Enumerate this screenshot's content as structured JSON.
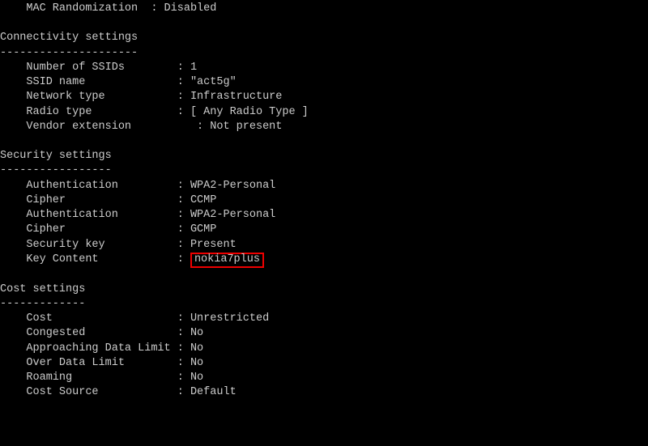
{
  "top": {
    "mac_rand_label": "    MAC Randomization  ",
    "mac_rand_value": " Disabled"
  },
  "sections": {
    "connectivity": {
      "title": "Connectivity settings",
      "dashes": "---------------------",
      "rows": {
        "num_ssids": {
          "label": "    Number of SSIDs        ",
          "value": " 1"
        },
        "ssid_name": {
          "label": "    SSID name              ",
          "value": " \"act5g\""
        },
        "network_type": {
          "label": "    Network type           ",
          "value": " Infrastructure"
        },
        "radio_type": {
          "label": "    Radio type             ",
          "value": " [ Any Radio Type ]"
        },
        "vendor_ext": {
          "label": "    Vendor extension          ",
          "value": " Not present"
        }
      }
    },
    "security": {
      "title": "Security settings",
      "dashes": "-----------------",
      "rows": {
        "auth1": {
          "label": "    Authentication         ",
          "value": " WPA2-Personal"
        },
        "cipher1": {
          "label": "    Cipher                 ",
          "value": " CCMP"
        },
        "auth2": {
          "label": "    Authentication         ",
          "value": " WPA2-Personal"
        },
        "cipher2": {
          "label": "    Cipher                 ",
          "value": " GCMP"
        },
        "sec_key": {
          "label": "    Security key           ",
          "value": " Present"
        },
        "key_content": {
          "label": "    Key Content            ",
          "value": "nokia7plus"
        }
      }
    },
    "cost": {
      "title": "Cost settings",
      "dashes": "-------------",
      "rows": {
        "cost": {
          "label": "    Cost                   ",
          "value": " Unrestricted"
        },
        "congested": {
          "label": "    Congested              ",
          "value": " No"
        },
        "approaching": {
          "label": "    Approaching Data Limit ",
          "value": " No"
        },
        "over": {
          "label": "    Over Data Limit        ",
          "value": " No"
        },
        "roaming": {
          "label": "    Roaming                ",
          "value": " No"
        },
        "cost_source": {
          "label": "    Cost Source            ",
          "value": " Default"
        }
      }
    }
  },
  "colon": ":",
  "key_prefix": ": "
}
